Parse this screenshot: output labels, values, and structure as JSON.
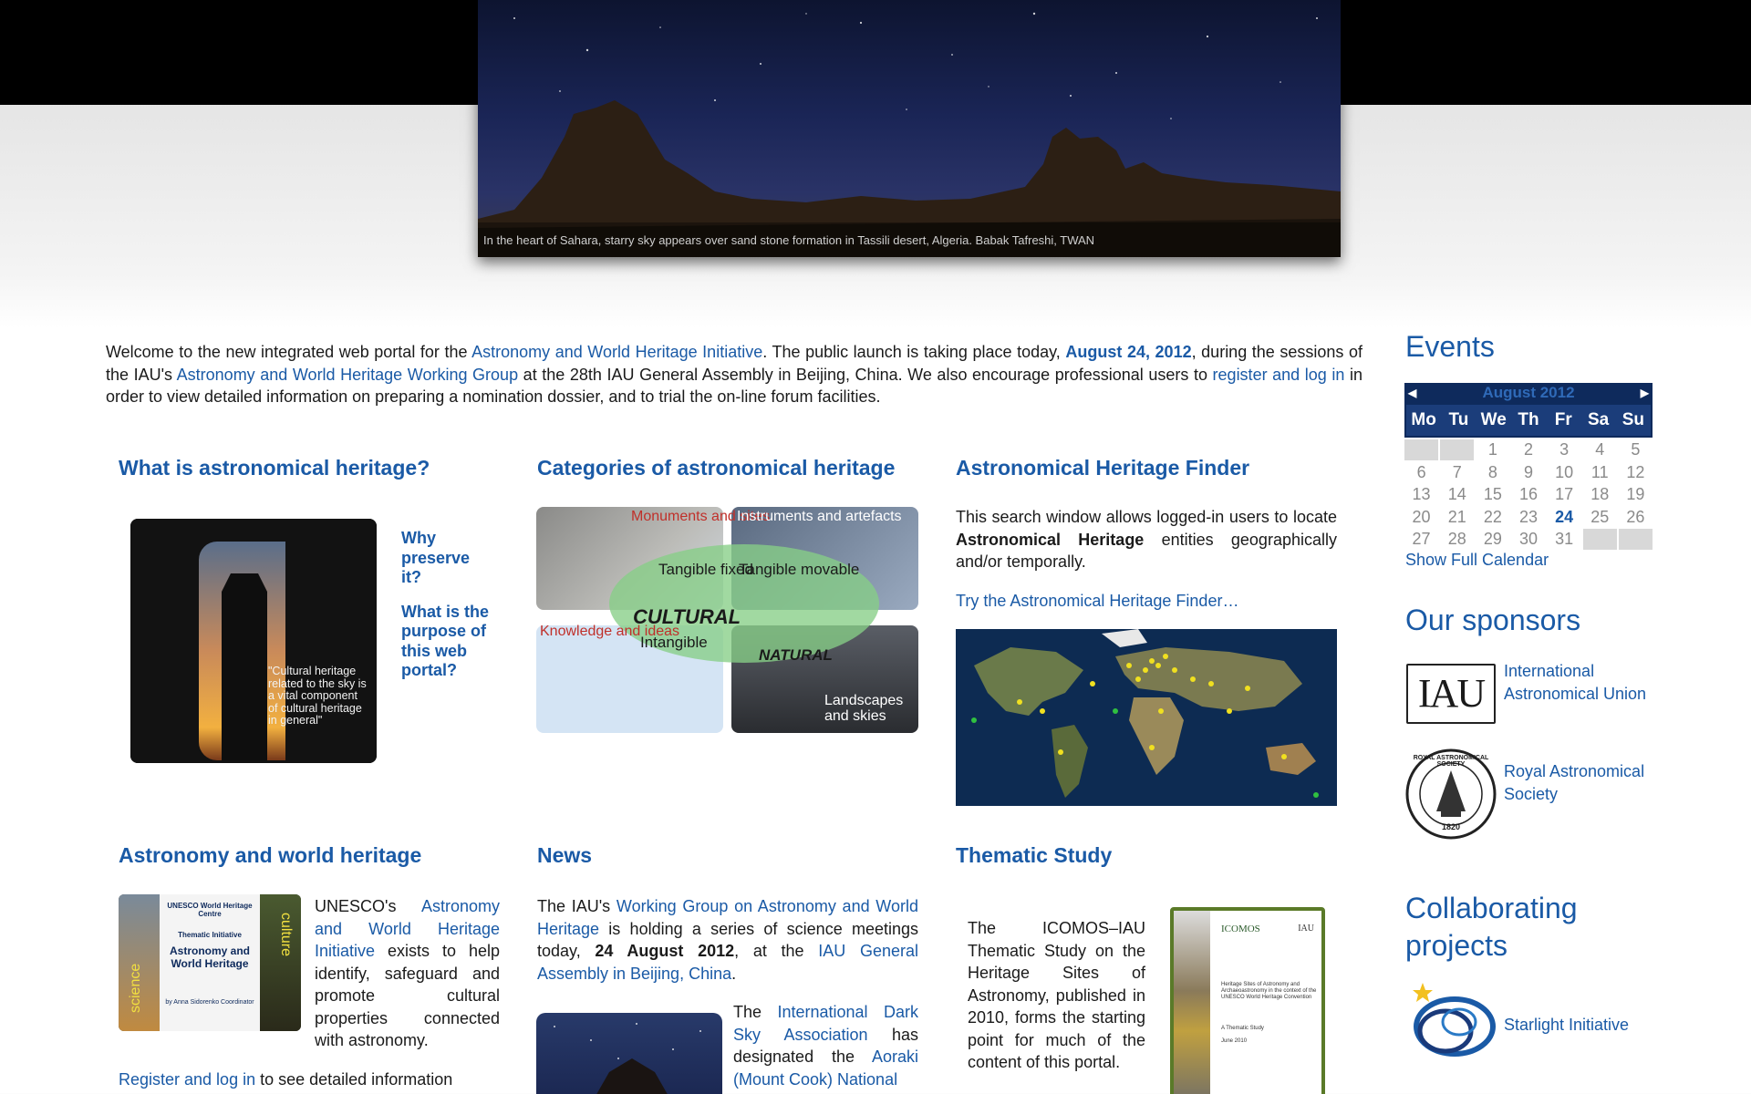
{
  "hero": {
    "caption": "In the heart of Sahara, starry sky appears over sand stone formation in Tassili desert, Algeria. Babak Tafreshi, TWAN"
  },
  "welcome": {
    "t1": "Welcome to the new integrated web portal for the ",
    "l1": "Astronomy and World Heritage Initiative",
    "t2": ". The public launch is taking place today, ",
    "date": "August 24, 2012",
    "t3": ", during the sessions of the IAU's ",
    "l2": "Astronomy and World Heritage Working Group",
    "t4": " at the 28th IAU General Assembly in Beijing, China. We also encourage professional users to ",
    "l3": "register and log in",
    "t5": " in order to view detailed information on preparing a nomination dossier, and to trial the on-line forum facilities."
  },
  "what_is": {
    "title": "What is astronomical heritage?",
    "quote": "\"Cultural heritage related to the sky is a vital component of cultural heritage in general\"",
    "link1": "Why preserve it?",
    "link2": "What is the purpose of this web portal?"
  },
  "categories": {
    "title": "Categories of astronomical heritage",
    "monuments": "Monuments and sites",
    "instruments": "Instruments and artefacts",
    "tangible_fixed": "Tangible fixed",
    "tangible_movable": "Tangible movable",
    "cultural": "CULTURAL",
    "knowledge": "Knowledge and ideas",
    "intangible": "Intangible",
    "natural": "NATURAL",
    "landscapes": "Landscapes and skies"
  },
  "finder": {
    "title": "Astronomical Heritage Finder",
    "t1": "This search window allows logged-in users to locate ",
    "bold": "Astronomical Heritage",
    "t2": " entities geographically and/or temporally.",
    "link": "Try the Astronomical Heritage Finder…"
  },
  "awh": {
    "title": "Astronomy and world heritage",
    "t1": "UNESCO's ",
    "link": "Astronomy and World Heritage Initiative",
    "t2": " exists to help identify, safeguard and promote cultural properties connected with astronomy.",
    "register_link": "Register and log in",
    "t3": " to see detailed information",
    "img_org": "UNESCO World Heritage Centre",
    "img_sub": "Thematic Initiative",
    "img_title": "Astronomy and World Heritage",
    "img_side1": "science",
    "img_side2": "culture",
    "img_by": "by Anna Sidorenko Coordinator"
  },
  "news": {
    "title": "News",
    "t1": "The IAU's ",
    "l1": "Working Group on Astronomy and World Heritage",
    "t2": " is holding a series of science meetings today, ",
    "bold": "24 August 2012",
    "t3": ", at the ",
    "l2": "IAU General Assembly in Beijing, China",
    "t4": ".",
    "t5": "The ",
    "l3": "International Dark Sky Association",
    "t6": " has designated the ",
    "l4": "Aoraki (Mount Cook) National"
  },
  "thematic": {
    "title": "Thematic Study",
    "text": "The ICOMOS–IAU Thematic Study on the Heritage Sites of Astronomy, published in 2010, forms the starting point for much of the content of this portal.",
    "book_org": "ICOMOS",
    "book_org2": "IAU",
    "book_title": "Heritage Sites of Astronomy and Archaeoastronomy in the context of the UNESCO World Heritage Convention",
    "book_sub": "A Thematic Study",
    "book_date": "June 2010"
  },
  "sidebar": {
    "events_title": "Events",
    "calendar": {
      "month": "August 2012",
      "days": [
        "Mo",
        "Tu",
        "We",
        "Th",
        "Fr",
        "Sa",
        "Su"
      ],
      "cells": [
        "",
        "",
        "1",
        "2",
        "3",
        "4",
        "5",
        "6",
        "7",
        "8",
        "9",
        "10",
        "11",
        "12",
        "13",
        "14",
        "15",
        "16",
        "17",
        "18",
        "19",
        "20",
        "21",
        "22",
        "23",
        "24",
        "25",
        "26",
        "27",
        "28",
        "29",
        "30",
        "31",
        "",
        ""
      ],
      "today": "24"
    },
    "calendar_link": "Show Full Calendar",
    "sponsors_title": "Our sponsors",
    "iau_logo": "IAU",
    "iau": "International Astronomical Union",
    "ras": "Royal Astronomical Society",
    "ras_seal_top": "ROYAL ASTRONOMICAL SOCIETY",
    "ras_year": "1820",
    "collab_title_1": "Collaborating",
    "collab_title_2": "projects",
    "starlight": "Starlight Initiative"
  },
  "colors": {
    "link": "#1a5aa6",
    "calendar_header": "#0e2a5c",
    "calendar_days": "#1b3d7a",
    "ellipse": "#86ce86"
  }
}
